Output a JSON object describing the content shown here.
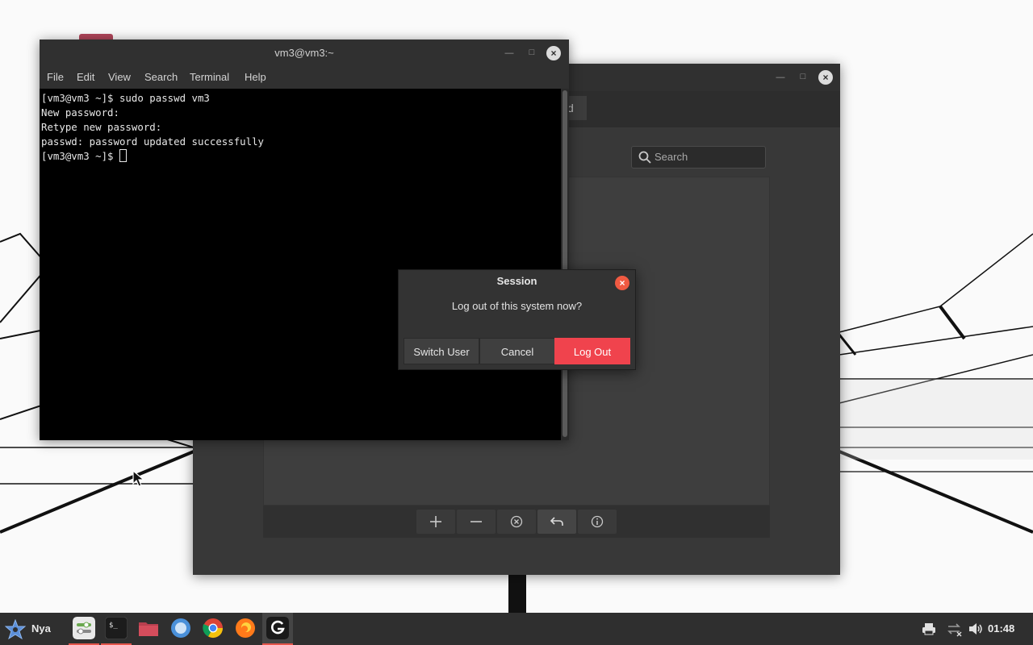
{
  "terminal": {
    "title": "vm3@vm3:~",
    "menu": [
      "File",
      "Edit",
      "View",
      "Search",
      "Terminal",
      "Help"
    ],
    "lines": [
      "[vm3@vm3 ~]$ sudo passwd vm3",
      "New password:",
      "Retype new password:",
      "passwd: password updated successfully",
      "[vm3@vm3 ~]$ "
    ]
  },
  "back_window": {
    "tab_fragment": "d",
    "search_placeholder": "Search",
    "toolbar_buttons": [
      "add-icon",
      "remove-icon",
      "clear-icon",
      "undo-icon",
      "info-icon"
    ]
  },
  "session_dialog": {
    "title": "Session",
    "message": "Log out of this system now?",
    "buttons": {
      "switch_user": "Switch User",
      "cancel": "Cancel",
      "log_out": "Log Out"
    },
    "danger_color": "#f0434d"
  },
  "taskbar": {
    "start_label": "Nya",
    "apps": [
      "settings-app-icon",
      "terminal-app-icon",
      "files-app-icon",
      "browser-app-icon",
      "chrome-app-icon",
      "firefox-app-icon",
      "user-manager-app-icon"
    ],
    "tray": [
      "printer-icon",
      "network-icon",
      "volume-icon"
    ],
    "clock": "01:48"
  }
}
